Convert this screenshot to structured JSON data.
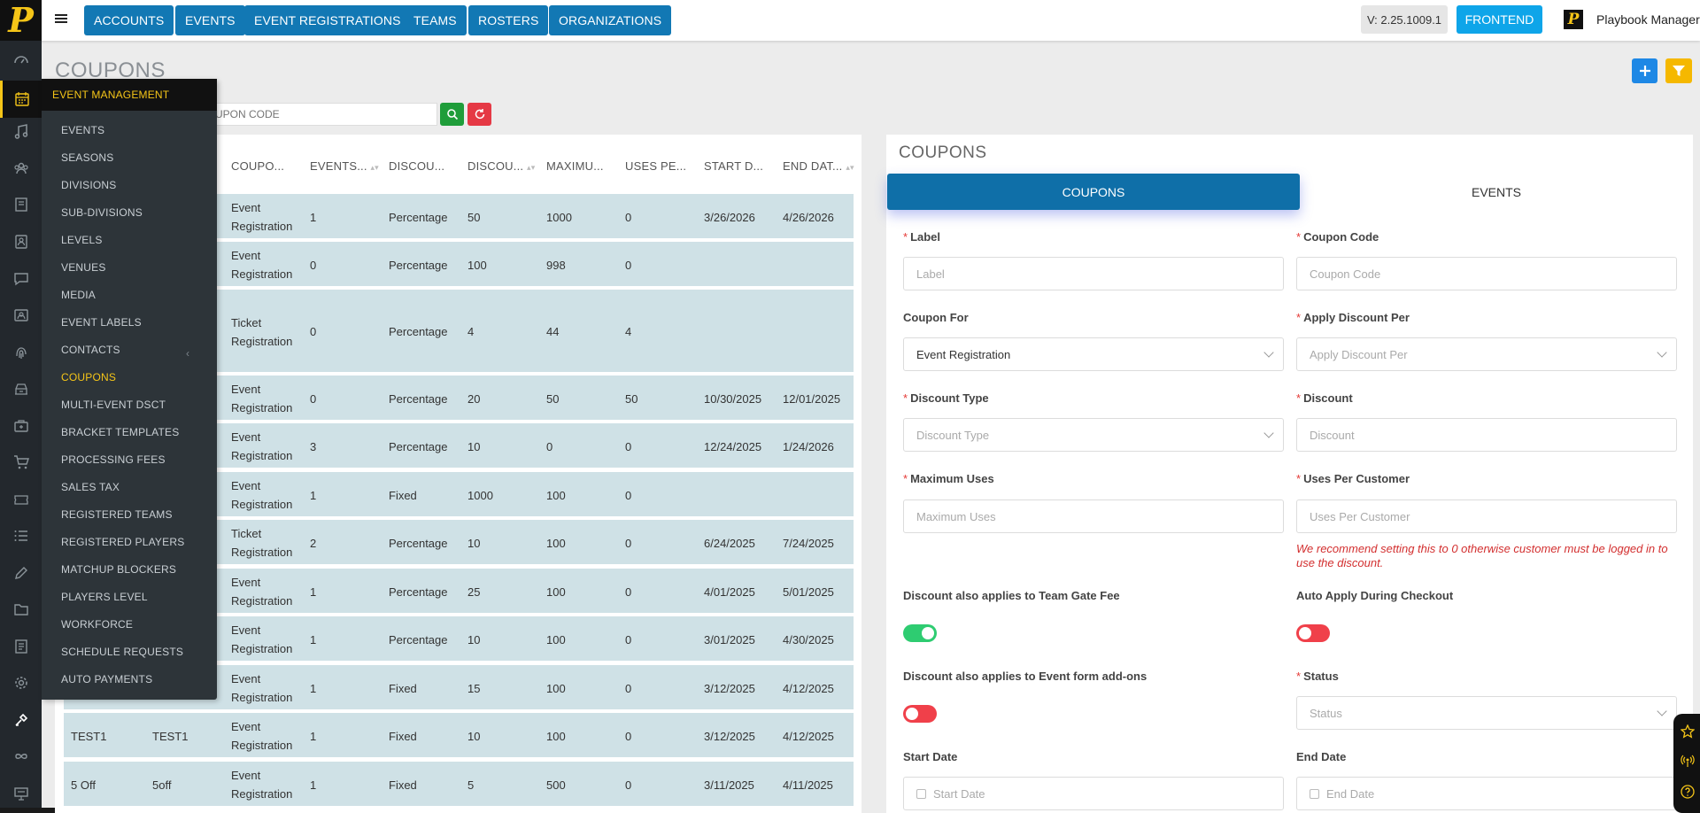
{
  "brand": {
    "logo_letter": "P",
    "accent": "#f5c518",
    "primary": "#1278b4"
  },
  "topnav": {
    "menu_icon": "hamburger-icon",
    "items": [
      {
        "label": "ACCOUNTS"
      },
      {
        "label": "EVENTS"
      },
      {
        "label": "EVENT REGISTRATIONS"
      },
      {
        "label": "TEAMS"
      },
      {
        "label": "ROSTERS"
      },
      {
        "label": "ORGANIZATIONS"
      }
    ],
    "version": "V: 2.25.1009.1",
    "frontend_label": "FRONTEND",
    "user_logo_letter": "P",
    "user_name": "Playbook Manager"
  },
  "rail_icons": [
    "dashboard-icon",
    "calendar-icon",
    "music-icon",
    "users-icon",
    "book-icon",
    "contacts-icon",
    "chat-icon",
    "id-card-icon",
    "fingerprint-icon",
    "venue-icon",
    "briefcase-icon",
    "cart-icon",
    "ticket-icon",
    "list-icon",
    "pen-icon",
    "folder-icon",
    "document-icon",
    "gear-icon",
    "tools-icon",
    "infinity-icon",
    "presentation-icon"
  ],
  "flyout": {
    "title": "EVENT MANAGEMENT",
    "items": [
      {
        "label": "EVENTS"
      },
      {
        "label": "SEASONS"
      },
      {
        "label": "DIVISIONS"
      },
      {
        "label": "SUB-DIVISIONS"
      },
      {
        "label": "LEVELS"
      },
      {
        "label": "VENUES"
      },
      {
        "label": "MEDIA"
      },
      {
        "label": "EVENT LABELS"
      },
      {
        "label": "CONTACTS"
      },
      {
        "label": "COUPONS"
      },
      {
        "label": "MULTI-EVENT DSCT"
      },
      {
        "label": "BRACKET TEMPLATES"
      },
      {
        "label": "PROCESSING FEES"
      },
      {
        "label": "SALES TAX"
      },
      {
        "label": "REGISTERED TEAMS"
      },
      {
        "label": "REGISTERED PLAYERS"
      },
      {
        "label": "MATCHUP BLOCKERS"
      },
      {
        "label": "PLAYERS LEVEL"
      },
      {
        "label": "WORKFORCE"
      },
      {
        "label": "SCHEDULE REQUESTS"
      },
      {
        "label": "AUTO PAYMENTS"
      }
    ],
    "caret": "‹"
  },
  "page": {
    "title": "COUPONS",
    "search_placeholder": "UPON CODE"
  },
  "table": {
    "columns": [
      "COUPO...",
      "EVENTS...",
      "DISCOU...",
      "DISCOU...",
      "MAXIMU...",
      "USES PE...",
      "START D...",
      "END DAT..."
    ],
    "rows": [
      {
        "label": "",
        "code": "",
        "for": "Event Registration",
        "events": "1",
        "type": "Percentage",
        "discount": "50",
        "max": "1000",
        "uses": "0",
        "start": "3/26/2026",
        "end": "4/26/2026"
      },
      {
        "label": "",
        "code": "",
        "for": "Event Registration",
        "events": "0",
        "type": "Percentage",
        "discount": "100",
        "max": "998",
        "uses": "0",
        "start": "",
        "end": ""
      },
      {
        "label": "",
        "code": "",
        "for": "Ticket Registration",
        "events": "0",
        "type": "Percentage",
        "discount": "4",
        "max": "44",
        "uses": "4",
        "start": "",
        "end": ""
      },
      {
        "label": "",
        "code": "",
        "for": "Event Registration",
        "events": "0",
        "type": "Percentage",
        "discount": "20",
        "max": "50",
        "uses": "50",
        "start": "10/30/2025",
        "end": "12/01/2025"
      },
      {
        "label": "",
        "code": "",
        "for": "Event Registration",
        "events": "3",
        "type": "Percentage",
        "discount": "10",
        "max": "0",
        "uses": "0",
        "start": "12/24/2025",
        "end": "1/24/2026"
      },
      {
        "label": "",
        "code": "",
        "for": "Event Registration",
        "events": "1",
        "type": "Fixed",
        "discount": "1000",
        "max": "100",
        "uses": "0",
        "start": "",
        "end": ""
      },
      {
        "label": "",
        "code": "",
        "for": "Ticket Registration",
        "events": "2",
        "type": "Percentage",
        "discount": "10",
        "max": "100",
        "uses": "0",
        "start": "6/24/2025",
        "end": "7/24/2025"
      },
      {
        "label": "",
        "code": "",
        "for": "Event Registration",
        "events": "1",
        "type": "Percentage",
        "discount": "25",
        "max": "100",
        "uses": "0",
        "start": "4/01/2025",
        "end": "5/01/2025"
      },
      {
        "label": "",
        "code": "",
        "for": "Event Registration",
        "events": "1",
        "type": "Percentage",
        "discount": "10",
        "max": "100",
        "uses": "0",
        "start": "3/01/2025",
        "end": "4/30/2025"
      },
      {
        "label": "",
        "code": "",
        "for": "Event Registration",
        "events": "1",
        "type": "Fixed",
        "discount": "15",
        "max": "100",
        "uses": "0",
        "start": "3/12/2025",
        "end": "4/12/2025"
      },
      {
        "label": "TEST1",
        "code": "TEST1",
        "for": "Event Registration",
        "events": "1",
        "type": "Fixed",
        "discount": "10",
        "max": "100",
        "uses": "0",
        "start": "3/12/2025",
        "end": "4/12/2025"
      },
      {
        "label": "5 Off",
        "code": "5off",
        "for": "Event Registration",
        "events": "1",
        "type": "Fixed",
        "discount": "5",
        "max": "500",
        "uses": "0",
        "start": "3/11/2025",
        "end": "4/11/2025"
      }
    ]
  },
  "form": {
    "title": "COUPONS",
    "tabs": {
      "coupons": "COUPONS",
      "events": "EVENTS"
    },
    "label": {
      "label": "Label",
      "placeholder": "Label"
    },
    "coupon_code": {
      "label": "Coupon Code",
      "placeholder": "Coupon Code"
    },
    "coupon_for": {
      "label": "Coupon For",
      "value": "Event Registration"
    },
    "apply_discount_per": {
      "label": "Apply Discount Per",
      "placeholder": "Apply Discount Per"
    },
    "discount_type": {
      "label": "Discount Type",
      "placeholder": "Discount Type"
    },
    "discount": {
      "label": "Discount",
      "placeholder": "Discount"
    },
    "maximum_uses": {
      "label": "Maximum Uses",
      "placeholder": "Maximum Uses"
    },
    "uses_per_customer": {
      "label": "Uses Per Customer",
      "placeholder": "Uses Per Customer"
    },
    "warning": "We recommend setting this to 0 otherwise customer must be logged in to use the discount.",
    "gate_fee": {
      "label": "Discount also applies to Team Gate Fee",
      "on": true
    },
    "auto_apply": {
      "label": "Auto Apply During Checkout",
      "on": false
    },
    "addons": {
      "label": "Discount also applies to Event form add-ons",
      "on": false
    },
    "status": {
      "label": "Status",
      "placeholder": "Status"
    },
    "start_date": {
      "label": "Start Date",
      "placeholder": "Start Date"
    },
    "end_date": {
      "label": "End Date",
      "placeholder": "End Date"
    },
    "required_mark": "*"
  },
  "widget_icons": [
    "star-icon",
    "broadcast-icon",
    "help-icon"
  ]
}
